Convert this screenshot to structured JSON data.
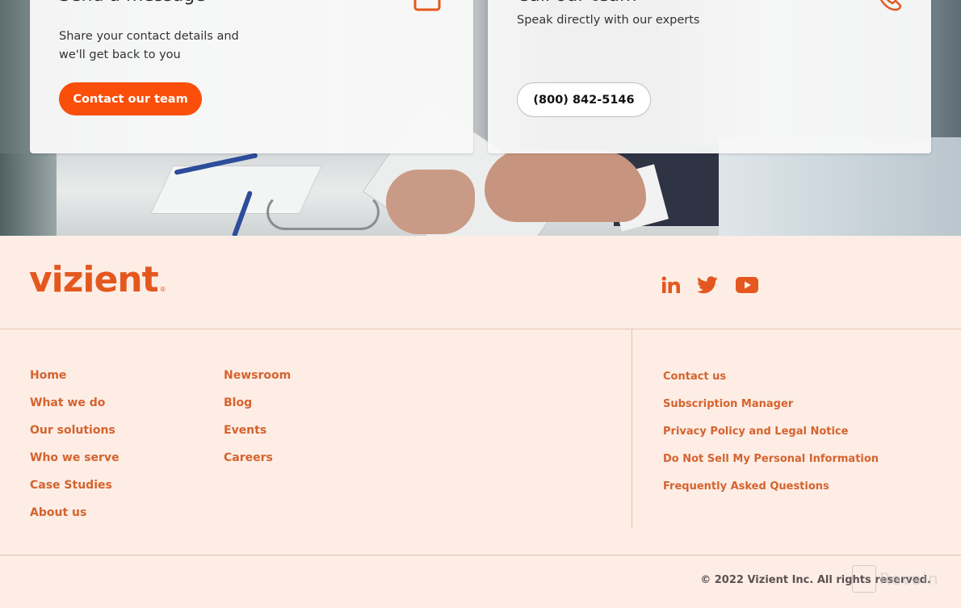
{
  "cards": {
    "message": {
      "title": "Send a message",
      "text": "Share your contact details and we'll get back to you",
      "button_label": "Contact our team",
      "icon": "envelope-icon"
    },
    "call": {
      "title": "Call our team",
      "text": "Speak directly with our experts",
      "phone_label": "(800) 842-5146",
      "icon": "phone-icon"
    }
  },
  "footer": {
    "logo_text": "vizient",
    "logo_mark": "®",
    "social": [
      {
        "name": "LinkedIn",
        "icon": "linkedin-icon"
      },
      {
        "name": "Twitter",
        "icon": "twitter-icon"
      },
      {
        "name": "YouTube",
        "icon": "youtube-icon"
      }
    ],
    "nav_primary": [
      "Home",
      "What we do",
      "Our solutions",
      "Who we serve",
      "Case Studies",
      "About us"
    ],
    "nav_secondary": [
      "Newsroom",
      "Blog",
      "Events",
      "Careers"
    ],
    "nav_legal": [
      "Contact us",
      "Subscription Manager",
      "Privacy Policy and Legal Notice",
      "Do Not Sell My Personal Information",
      "Frequently Asked Questions"
    ],
    "copyright": "© 2022 Vizient Inc. All rights reserved."
  },
  "watermark": "Revain",
  "colors": {
    "brand_orange": "#fa4f0a",
    "link_orange": "#d5632e",
    "footer_bg": "#fdede5"
  }
}
